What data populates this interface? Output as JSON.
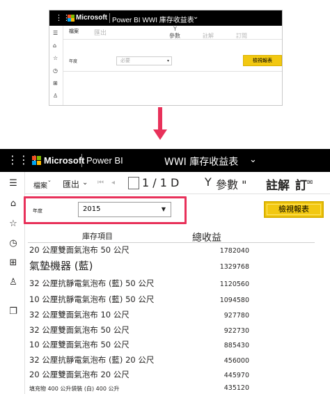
{
  "colors": {
    "accent": "#e8315a",
    "button_yellow": "#f2c811",
    "topbar": "#000000"
  },
  "thumbnail": {
    "brand": "Microsoft",
    "title": "Power BI WWI 庫存收益表",
    "toolbar": {
      "file": "檔案",
      "export": "匯出",
      "params": "參數",
      "params_icon": "Y",
      "comment": "註解",
      "subscribe": "訂閱"
    },
    "filter_label": "年度",
    "select_placeholder": "必要",
    "view_report": "檢視報表"
  },
  "app": {
    "brand": "Microsoft",
    "product": "Power BI",
    "report_title": "WWI 庫存收益表"
  },
  "sidebar_icons": [
    "hamburger-icon",
    "home-icon",
    "favorites-icon",
    "recent-icon",
    "apps-icon",
    "shared-icon",
    "workspaces-icon"
  ],
  "toolbar": {
    "file": "檔案",
    "export": "匯出",
    "page_indicator": "1 / 1 D",
    "params_icon": "Y",
    "params": "參數 \"",
    "comment": "註解",
    "subscribe": "訂"
  },
  "filter": {
    "label": "年度",
    "value": "2015",
    "view_report": "檢視報表"
  },
  "table": {
    "headers": {
      "item": "庫存項目",
      "total": "總收益"
    },
    "rows": [
      {
        "item": "20 公厘雙面氣泡布 50 公尺",
        "value": "1782040",
        "size": "m"
      },
      {
        "item": "氣墊機器 (藍)",
        "value": "1329768",
        "size": "l"
      },
      {
        "item": "32 公厘抗靜電氣泡布 (藍) 50 公尺",
        "value": "1120560",
        "size": "m"
      },
      {
        "item": "10 公厘抗靜電氣泡布 (藍) 50 公尺",
        "value": "1094580",
        "size": "m"
      },
      {
        "item": "32 公厘雙面氣泡布 10 公尺",
        "value": "927780",
        "size": "m"
      },
      {
        "item": "32 公厘雙面氣泡布 50 公尺",
        "value": "922730",
        "size": "m"
      },
      {
        "item": "10 公厘雙面氣泡布 50 公尺",
        "value": "885430",
        "size": "m"
      },
      {
        "item": "32 公厘抗靜電氣泡布 (藍) 20 公尺",
        "value": "456000",
        "size": "m"
      },
      {
        "item": "20 公厘雙面氣泡布 20 公尺",
        "value": "445970",
        "size": "m"
      },
      {
        "item": "填充物 400 公升袋裝 (白) 400 公升",
        "value": "435120",
        "size": "s"
      }
    ]
  }
}
